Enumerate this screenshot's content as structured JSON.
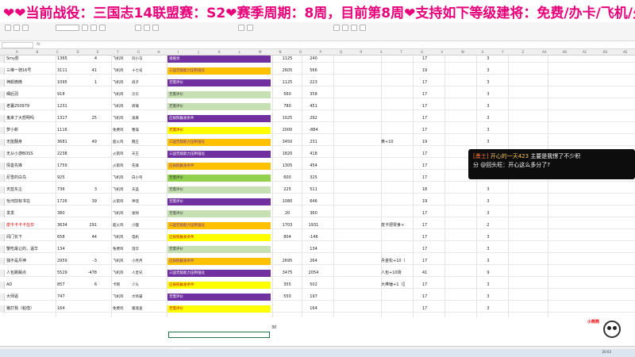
{
  "banner": {
    "text": "❤❤当前战役：三国志14联盟赛：S2❤赛季周期：8周，目前第8周❤支持如下等级建将：免费/办卡/飞机/火箭/超火，"
  },
  "formula_bar": {
    "cell_ref": "",
    "fx": "fx"
  },
  "columns": [
    "A",
    "B",
    "C",
    "D",
    "E",
    "F",
    "G",
    "H",
    "I",
    "J",
    "K",
    "L",
    "M",
    "N",
    "O",
    "P",
    "Q",
    "R",
    "S",
    "T",
    "U",
    "V",
    "W",
    "X",
    "Y",
    "Z",
    "AA",
    "AB",
    "AC",
    "AD",
    "AE"
  ],
  "rows": [
    {
      "name": "Smy影",
      "c1": "1365",
      "c2": "4",
      "c3": "飞机鸡",
      "c4": "刘小马",
      "desc": "诸葛亮",
      "desc_color": "purple",
      "v1": "1125",
      "v2": "240",
      "v4": "17",
      "v5": "3"
    },
    {
      "name": "三维一骑16号",
      "c1": "3111",
      "c2": "41",
      "c3": "飞机鸡",
      "c4": "十七号",
      "desc": "三国无敌能力压制强化",
      "desc_color": "orange",
      "v1": "2605",
      "v2": "566",
      "v4": "19",
      "v5": "3"
    },
    {
      "name": "神颜微微",
      "c1": "1095",
      "c2": "1",
      "c3": "飞机鸡",
      "c4": "浪子",
      "desc": "无需评价",
      "desc_color": "purple",
      "v1": "1125",
      "v2": "223",
      "v4": "17",
      "v5": "3"
    },
    {
      "name": "细后羽",
      "c1": "918",
      "c2": "",
      "c3": "飞机鸡",
      "c4": "贝贝",
      "desc": "无需评价",
      "desc_color": "lgreen",
      "v1": "560",
      "v2": "358",
      "v4": "17",
      "v5": "3"
    },
    {
      "name": "老薯250979",
      "c1": "1231",
      "c2": "",
      "c3": "飞机鸡",
      "c4": "周瑜",
      "desc": "无需评价",
      "desc_color": "lgreen",
      "v1": "780",
      "v2": "451",
      "v4": "17",
      "v5": "3"
    },
    {
      "name": "鬼来了大怒明吗",
      "c1": "1317",
      "c2": "25",
      "c3": "飞机鸡",
      "c4": "鬼来",
      "desc": "应按照触发条件",
      "desc_color": "purple",
      "v1": "1025",
      "v2": "292",
      "v4": "17",
      "v5": "3"
    },
    {
      "name": "梦小新",
      "c1": "1116",
      "c2": "",
      "c3": "免费鸡",
      "c4": "曹操",
      "desc": "无需评价",
      "desc_color": "yellow",
      "v1": "2000",
      "v2": "-884",
      "v4": "17",
      "v5": "3"
    },
    {
      "name": "无能翻身",
      "c1": "3681",
      "c2": "49",
      "c3": "超火鸡",
      "c4": "魏王",
      "desc": "三国无敌能力压制强化",
      "desc_color": "orange",
      "v1": "3450",
      "v2": "231",
      "v3": "黄+10",
      "v4": "19",
      "v5": "3"
    },
    {
      "name": "无从小游BOSS",
      "c1": "2238",
      "c2": "",
      "c3": "火箭鸡",
      "c4": "天王",
      "desc": "三国无敌能力压制强化",
      "desc_color": "purple",
      "v1": "1820",
      "v2": "418",
      "v4": "17",
      "v5": "3"
    },
    {
      "name": "情善先锋",
      "c1": "1759",
      "c2": "",
      "c3": "火箭鸡",
      "c4": "先锋",
      "desc": "应按照触发条件",
      "desc_color": "orange",
      "v1": "1305",
      "v2": "454",
      "v4": "17",
      "v5": "3"
    },
    {
      "name": "尼雪的白鸟",
      "c1": "925",
      "c2": "",
      "c3": "飞机鸡",
      "c4": "白小鸟",
      "desc": "无需评价",
      "desc_color": "green",
      "v1": "600",
      "v2": "325",
      "v4": "17",
      "v5": "3"
    },
    {
      "name": "天蓝东尘",
      "c1": "736",
      "c2": "3",
      "c3": "飞机鸡",
      "c4": "天蓝",
      "desc": "无需评价",
      "desc_color": "lgreen",
      "v1": "225",
      "v2": "511",
      "v4": "18",
      "v5": "3"
    },
    {
      "name": "怡河前有书在",
      "c1": "1726",
      "c2": "39",
      "c3": "火箭鸡",
      "c4": "神话",
      "desc": "无需评价",
      "desc_color": "purple",
      "v1": "1080",
      "v2": "646",
      "v4": "19",
      "v5": "3"
    },
    {
      "name": "发发",
      "c1": "380",
      "c2": "",
      "c3": "飞机鸡",
      "c4": "发财",
      "desc": "无需评价",
      "desc_color": "lgreen",
      "v1": "20",
      "v2": "360",
      "v4": "17",
      "v5": "3"
    },
    {
      "name": "皮卡卡卡卡在日",
      "c1": "3634",
      "c2": "291",
      "c3": "超火鸡",
      "c4": "小狸",
      "desc": "三国无敌能力压制强化",
      "desc_color": "orange",
      "v1": "1703",
      "v2": "1931",
      "v3": "皮卡把零食+10",
      "v4": "17",
      "v5": "2",
      "red": true
    },
    {
      "name": "闻门长下",
      "c1": "658",
      "c2": "44",
      "c3": "飞机鸡",
      "c4": "电机",
      "desc": "应按照触发条件",
      "desc_color": "yellow",
      "v1": "804",
      "v2": "-146",
      "v4": "17",
      "v5": "3"
    },
    {
      "name": "蟹吃最让的，温华",
      "c1": "134",
      "c2": "",
      "c3": "免费鸡",
      "c4": "温华",
      "desc": "无需评价",
      "desc_color": "lgreen",
      "v1": "",
      "v2": "134",
      "v4": "17",
      "v5": "3"
    },
    {
      "name": "独不是月神",
      "c1": "2959",
      "c2": "-3",
      "c3": "飞机鸡",
      "c4": "小月月",
      "desc": "应按照触发条件",
      "desc_color": "orange",
      "v1": "2695",
      "v2": "264",
      "v3": "月金松+10（赛",
      "v4": "17",
      "v5": "3"
    },
    {
      "name": "人包跳踢点",
      "c1": "5529",
      "c2": "-478",
      "c3": "飞机鸡",
      "c4": "人皇兄",
      "desc": "三国无敌能力压制强化",
      "desc_color": "purple",
      "v1": "3475",
      "v2": "2054",
      "v3": "人包+10场",
      "v4": "41",
      "v5": "9"
    },
    {
      "name": "AD",
      "c1": "857",
      "c2": "6",
      "c3": "卡网",
      "c4": "少头",
      "desc": "应按照触发条件",
      "desc_color": "yellow",
      "v1": "355",
      "v2": "502",
      "v3": "大棒锤+1（区",
      "v4": "17",
      "v5": "3"
    },
    {
      "name": "大师逼",
      "c1": "747",
      "c2": "",
      "c3": "飞机鸡",
      "c4": "大师逼",
      "desc": "无需评价",
      "desc_color": "purple",
      "v1": "550",
      "v2": "197",
      "v4": "17",
      "v5": "3"
    },
    {
      "name": "猪打我（粘借）",
      "c1": "164",
      "c2": "",
      "c3": "免费鸡",
      "c4": "猪逐查",
      "desc": "无需评价",
      "desc_color": "yellow",
      "v1": "",
      "v2": "164",
      "v4": "17",
      "v5": "3"
    }
  ],
  "sum_value": "30",
  "sheet_tabs": [
    "比赛场地(1)",
    "赛事记录",
    "比赛排名",
    "赛事积分",
    "报名",
    "积分",
    "比分记录",
    "比赛信息表",
    "历史战绩"
  ],
  "active_tab_index": 6,
  "taskbar_time": "20:03",
  "chat": {
    "badge": "[勇士]",
    "username": "开心的一天423",
    "message_1": "主要是我愣了不少积",
    "message_2": "分 @回头旺：开心这么多分了?"
  },
  "mascot_label": "小熊熊"
}
